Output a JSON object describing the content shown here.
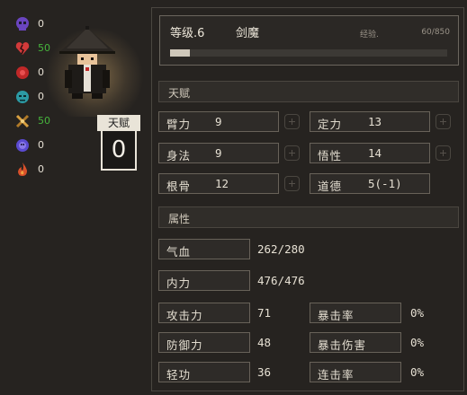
{
  "status_icons": [
    {
      "icon": "purple-skull-icon",
      "value": "0",
      "color": "#7b4fd0"
    },
    {
      "icon": "broken-heart-icon",
      "value": "50",
      "color": "#d23a3a"
    },
    {
      "icon": "red-orb-icon",
      "value": "0",
      "color": "#c83232"
    },
    {
      "icon": "teal-demon-icon",
      "value": "0",
      "color": "#3aa8b0"
    },
    {
      "icon": "crossed-bones-icon",
      "value": "50",
      "color": "#d8a040"
    },
    {
      "icon": "blue-ghost-icon",
      "value": "0",
      "color": "#6a5ad8"
    },
    {
      "icon": "flame-icon",
      "value": "0",
      "color": "#d85a2a"
    }
  ],
  "talent_badge": {
    "label": "天赋",
    "value": "0"
  },
  "header": {
    "level": "等级.6",
    "title": "剑魔",
    "exp_label": "经验.",
    "exp_value": "60/850",
    "exp_progress": 0.0706
  },
  "talent_section": {
    "title": "天赋"
  },
  "talent_stats": {
    "strength_label": "臂力",
    "strength_value": "9",
    "focus_label": "定力",
    "focus_value": "13",
    "agility_label": "身法",
    "agility_value": "9",
    "insight_label": "悟性",
    "insight_value": "14",
    "constitution_label": "根骨",
    "constitution_value": "12",
    "morality_label": "道德",
    "morality_value": "5(-1)"
  },
  "attribute_section": {
    "title": "属性"
  },
  "attributes": {
    "hp_label": "气血",
    "hp_value": "262/280",
    "mp_label": "内力",
    "mp_value": "476/476",
    "attack_label": "攻击力",
    "attack_value": "71",
    "crit_rate_label": "暴击率",
    "crit_rate_value": "0%",
    "defense_label": "防御力",
    "defense_value": "48",
    "crit_damage_label": "暴击伤害",
    "crit_damage_value": "0%",
    "agility_label": "轻功",
    "agility_value": "36",
    "combo_rate_label": "连击率",
    "combo_rate_value": "0%"
  },
  "colors": {
    "accent_green": "#46b43c",
    "background": "#262320",
    "border": "#686259"
  }
}
